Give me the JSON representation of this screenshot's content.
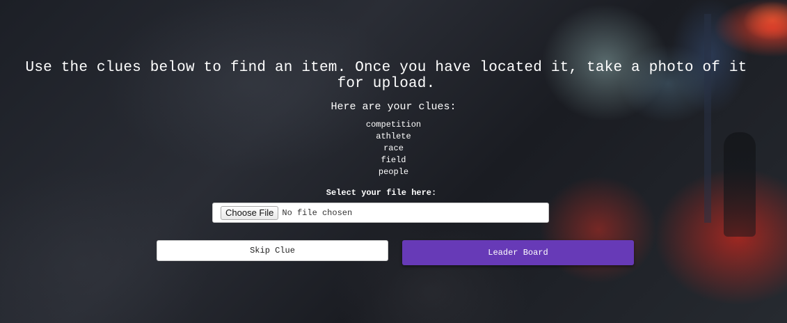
{
  "page": {
    "instructions": "Use the clues below to find an item. Once you have located it, take a photo of it for upload.",
    "clues_heading": "Here are your clues:",
    "clues": [
      "competition",
      "athlete",
      "race",
      "field",
      "people"
    ],
    "file_label": "Select your file here:",
    "file_input": {
      "button_label": "Choose File",
      "status": "No file chosen"
    },
    "buttons": {
      "skip_label": "Skip Clue",
      "leaderboard_label": "Leader Board"
    }
  },
  "colors": {
    "accent": "#673ab7",
    "background": "#1c1f26"
  }
}
